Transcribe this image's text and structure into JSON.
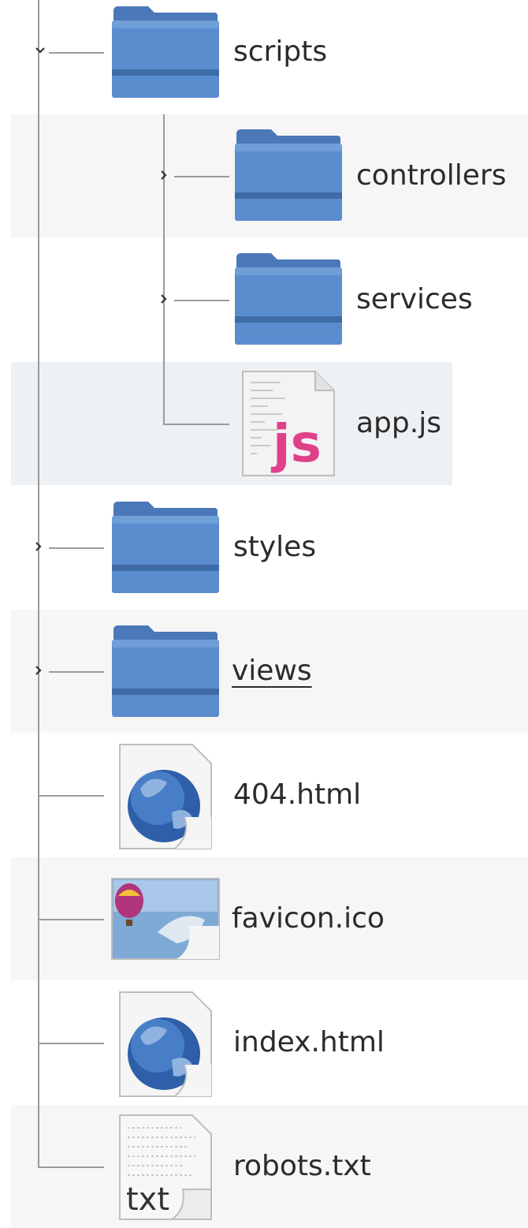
{
  "tree": {
    "items": [
      {
        "name": "scripts",
        "type": "folder",
        "depth": 1,
        "expander": "expanded"
      },
      {
        "name": "controllers",
        "type": "folder",
        "depth": 2,
        "expander": "collapsed"
      },
      {
        "name": "services",
        "type": "folder",
        "depth": 2,
        "expander": "collapsed"
      },
      {
        "name": "app.js",
        "type": "js",
        "depth": 2,
        "expander": "none",
        "selected": true
      },
      {
        "name": "styles",
        "type": "folder",
        "depth": 1,
        "expander": "collapsed"
      },
      {
        "name": "views",
        "type": "folder",
        "depth": 1,
        "expander": "collapsed",
        "hovered": true
      },
      {
        "name": "404.html",
        "type": "html",
        "depth": 1,
        "expander": "none"
      },
      {
        "name": "favicon.ico",
        "type": "ico",
        "depth": 1,
        "expander": "none"
      },
      {
        "name": "index.html",
        "type": "html",
        "depth": 1,
        "expander": "none"
      },
      {
        "name": "robots.txt",
        "type": "txt",
        "depth": 1,
        "expander": "none"
      }
    ],
    "txt_icon_text": "txt",
    "js_icon_text": "js"
  },
  "colors": {
    "folder_body": "#5b8dce",
    "folder_dark": "#3e6aa6",
    "row_alt": "#f6f6f6",
    "tree_line": "#9a9a9a",
    "js_pink": "#e0408a"
  },
  "icons": {
    "expanded": "chevron-down-icon",
    "collapsed": "chevron-right-icon",
    "folder": "folder-icon",
    "js": "javascript-file-icon",
    "html": "html-globe-file-icon",
    "ico": "image-file-icon",
    "txt": "text-file-icon"
  }
}
